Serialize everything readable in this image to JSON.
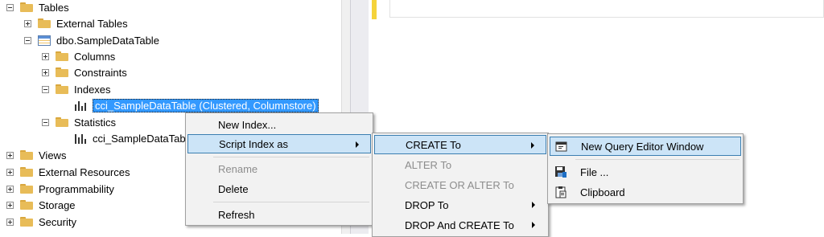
{
  "explorer": {
    "nodes": {
      "tables": "Tables",
      "external_tables": "External Tables",
      "sample_table": "dbo.SampleDataTable",
      "columns": "Columns",
      "constraints": "Constraints",
      "indexes": "Indexes",
      "cci_index": "cci_SampleDataTable (Clustered, Columnstore)",
      "statistics": "Statistics",
      "cci_stat": "cci_SampleDataTab",
      "views": "Views",
      "external_resources": "External Resources",
      "programmability": "Programmability",
      "storage": "Storage",
      "security": "Security"
    }
  },
  "context_menu": {
    "new_index": "New Index...",
    "script_index_as": "Script Index as",
    "rename": "Rename",
    "delete": "Delete",
    "refresh": "Refresh"
  },
  "script_menu": {
    "create_to": "CREATE To",
    "alter_to": "ALTER To",
    "create_or_alter_to": "CREATE OR ALTER To",
    "drop_to": "DROP To",
    "drop_and_create_to": "DROP And CREATE To"
  },
  "create_menu": {
    "new_query_editor_window": "New Query Editor Window",
    "file": "File ...",
    "clipboard": "Clipboard"
  },
  "colors": {
    "selection": "#3399ff",
    "menu_highlight": "#cce4f7",
    "menu_highlight_border": "#3c7fb1",
    "folder": "#e8bc58"
  }
}
